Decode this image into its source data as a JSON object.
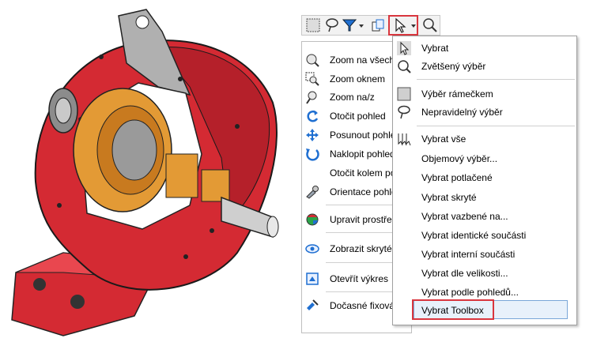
{
  "toolbar": {
    "icons": [
      "box-select-icon",
      "lasso-icon",
      "filter-icon",
      "dropdown-arrow-icon",
      "copy-selection-icon",
      "cursor-arrow-icon",
      "dropdown-arrow-icon",
      "magnifier-select-icon"
    ],
    "highlight_color": "#d9363e"
  },
  "left_menu": {
    "items": [
      {
        "label": "Zoom na všechny",
        "icon": "zoom-fit-icon"
      },
      {
        "label": "Zoom oknem",
        "icon": "zoom-window-icon"
      },
      {
        "label": "Zoom na/z",
        "icon": "zoom-in-out-icon"
      },
      {
        "label": "Otočit pohled",
        "icon": "rotate-view-icon"
      },
      {
        "label": "Posunout pohled",
        "icon": "pan-view-icon"
      },
      {
        "label": "Naklopit pohled",
        "icon": "tilt-view-icon"
      },
      {
        "label": "Otočit kolem počátku",
        "icon": ""
      },
      {
        "label": "Orientace pohledu",
        "icon": "view-orientation-icon"
      },
      {
        "label": "Upravit prostředí",
        "icon": "edit-appearance-icon"
      },
      {
        "label": "Zobrazit skryté",
        "icon": "show-hidden-icon"
      },
      {
        "label": "Otevřít výkres",
        "icon": "open-drawing-icon"
      },
      {
        "label": "Dočasné fixování",
        "icon": "temp-fix-icon"
      }
    ]
  },
  "dropdown": {
    "items": [
      {
        "label": "Vybrat",
        "icon": "cursor-arrow-icon"
      },
      {
        "label": "Zvětšený výběr",
        "icon": "magnified-select-icon"
      },
      {
        "label": "Výběr rámečkem",
        "icon": "box-select-icon"
      },
      {
        "label": "Nepravidelný výběr",
        "icon": "lasso-icon"
      },
      {
        "label": "Vybrat vše",
        "icon": "select-all-icon"
      },
      {
        "label": "Objemový výběr...",
        "icon": ""
      },
      {
        "label": "Vybrat potlačené",
        "icon": ""
      },
      {
        "label": "Vybrat skryté",
        "icon": ""
      },
      {
        "label": "Vybrat vazbené na...",
        "icon": ""
      },
      {
        "label": "Vybrat identické součásti",
        "icon": ""
      },
      {
        "label": "Vybrat interní součásti",
        "icon": ""
      },
      {
        "label": "Vybrat dle velikosti...",
        "icon": ""
      },
      {
        "label": "Vybrat podle pohledů...",
        "icon": ""
      },
      {
        "label": "Vybrat Toolbox",
        "icon": ""
      }
    ],
    "highlighted": "Vybrat Toolbox"
  },
  "colors": {
    "housing_red": "#d42a33",
    "gear_orange": "#e39a35",
    "accent_blue": "#1f6fd1"
  }
}
